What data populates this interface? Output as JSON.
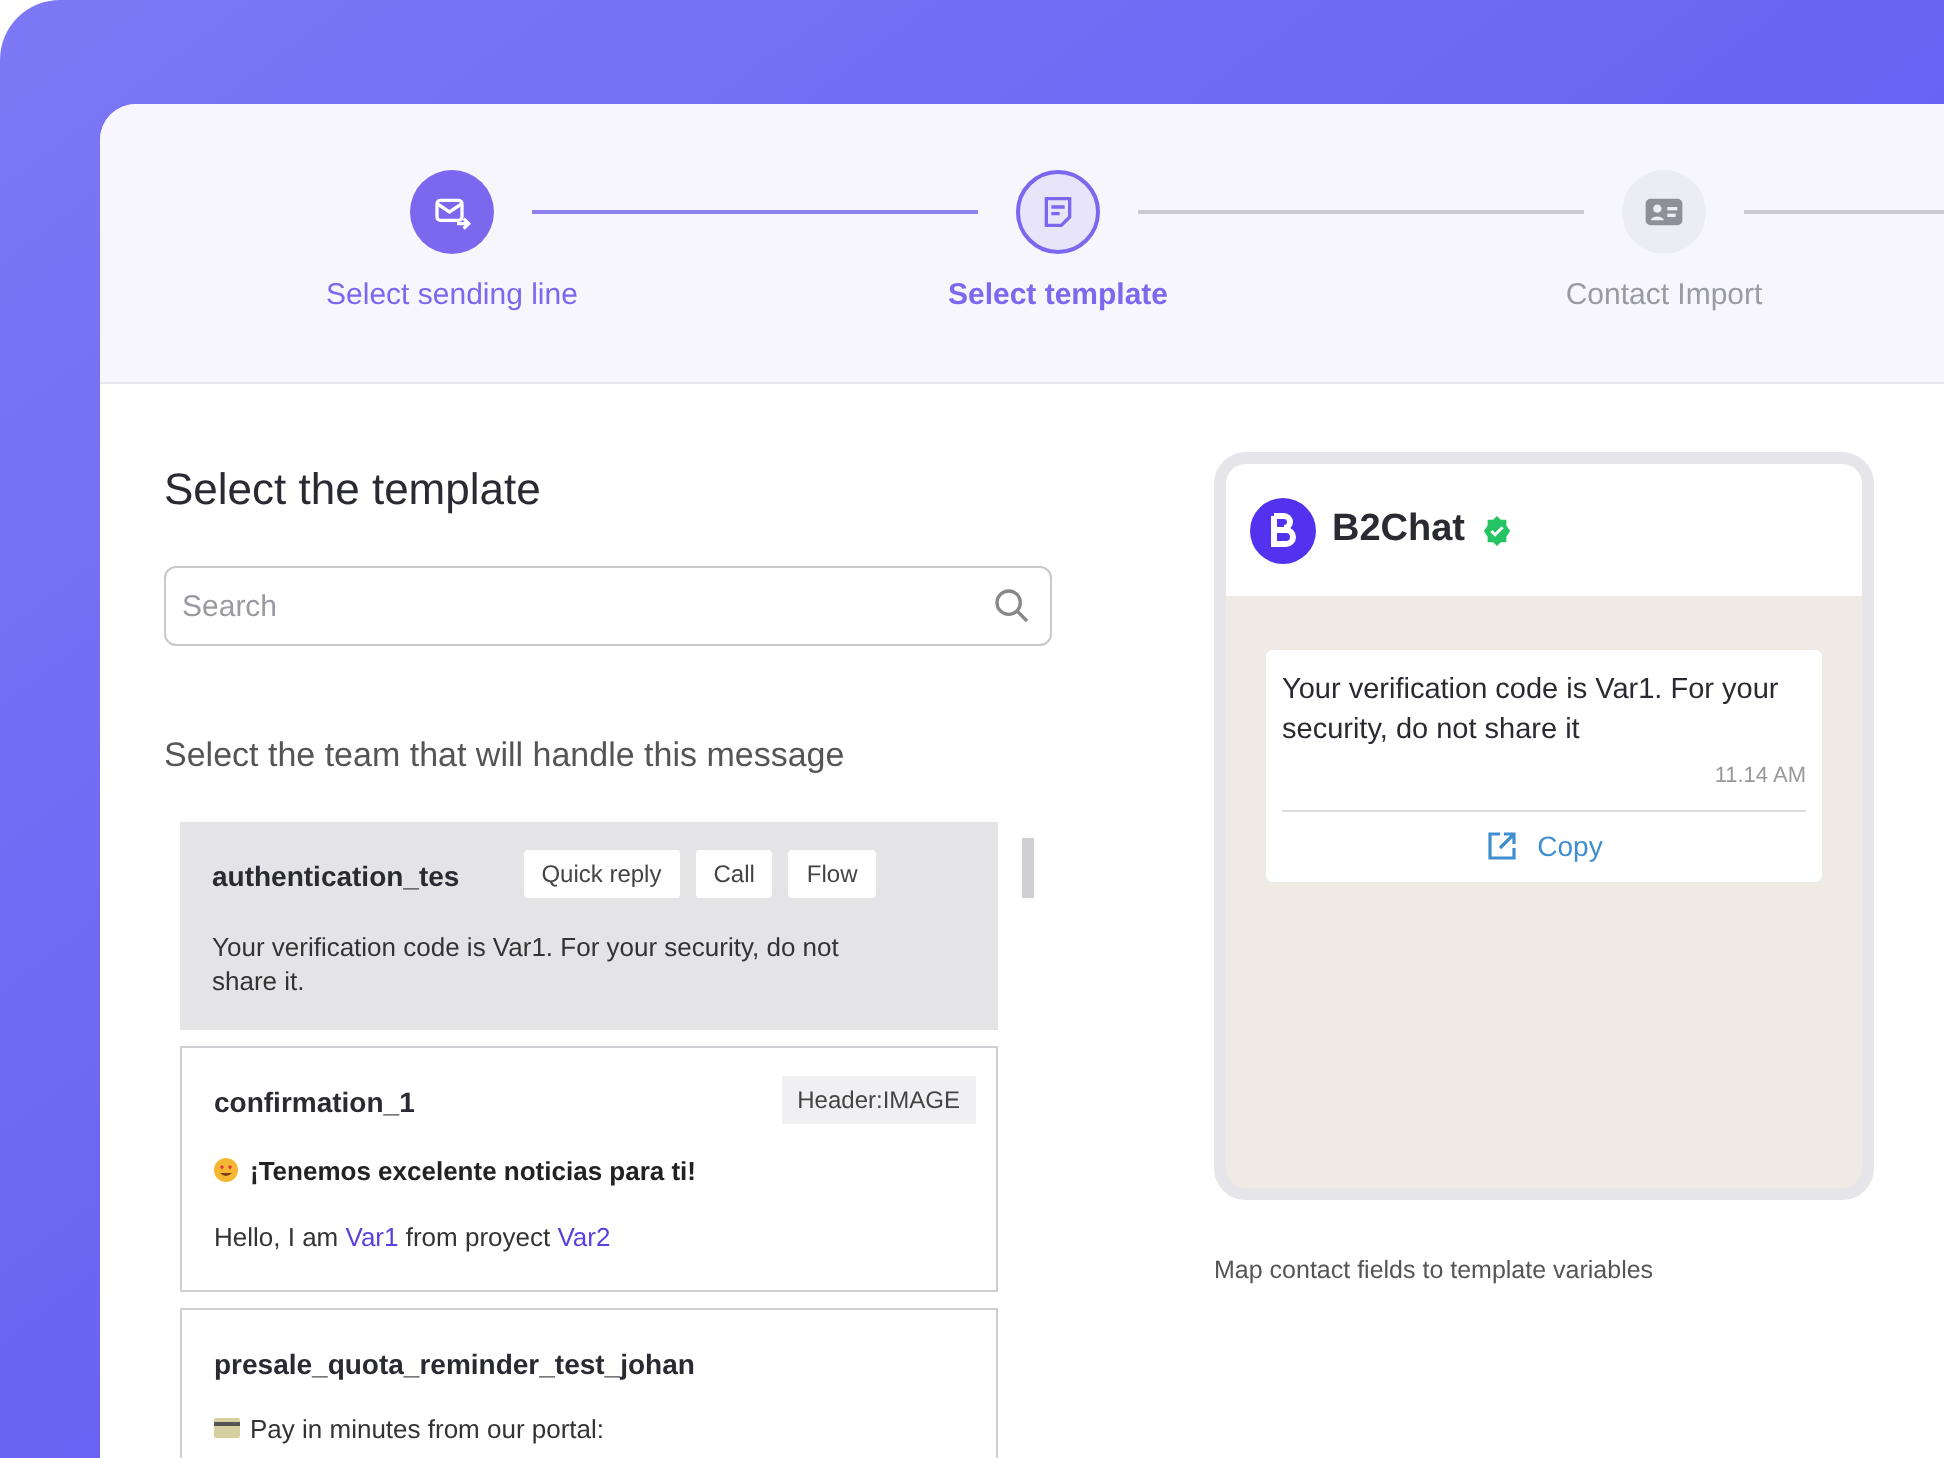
{
  "steps": [
    {
      "label": "Select sending line",
      "done": true,
      "selected": false
    },
    {
      "label": "Select template",
      "done": false,
      "selected": true
    },
    {
      "label": "Contact Import",
      "done": false,
      "selected": false
    }
  ],
  "title": "Select the template",
  "search": {
    "placeholder": "Search"
  },
  "team_prompt": "Select the team that will handle this message",
  "templates": [
    {
      "name": "authentication_tes",
      "selected": true,
      "tags": [
        "Quick reply",
        "Call",
        "Flow"
      ],
      "body": [
        {
          "kind": "plain",
          "text": "Your verification code is Var1. For your security, do not share it."
        }
      ]
    },
    {
      "name": "confirmation_1",
      "selected": false,
      "header_tag": "Header:IMAGE",
      "body": [
        {
          "kind": "headline",
          "text": "¡Tenemos excelente noticias para ti!"
        },
        {
          "kind": "segments",
          "segments": [
            {
              "text": "Hello, I am ",
              "variable": false
            },
            {
              "text": "Var1",
              "variable": true
            },
            {
              "text": " from proyect ",
              "variable": false
            },
            {
              "text": "Var2",
              "variable": true
            }
          ]
        }
      ]
    },
    {
      "name": "presale_quota_reminder_test_johan",
      "selected": false,
      "body": [
        {
          "kind": "payment",
          "text": "Pay in minutes from our portal:"
        }
      ]
    }
  ],
  "preview": {
    "sender": "B2Chat",
    "verified": true,
    "message": "Your verification code is Var1. For your security, do not share it",
    "time": "11.14 AM",
    "action": "Copy"
  },
  "map_hint": "Map contact fields to template variables"
}
